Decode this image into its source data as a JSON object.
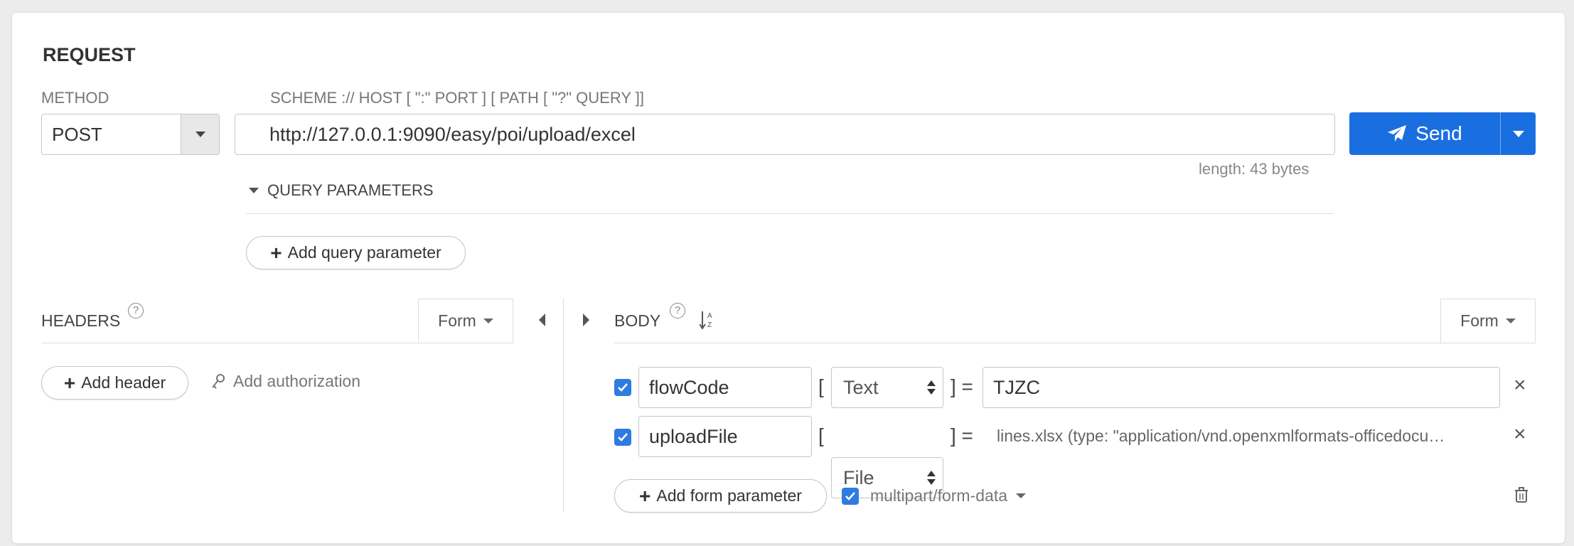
{
  "request": {
    "title": "REQUEST",
    "method_label": "METHOD",
    "method_value": "POST",
    "scheme_label": "SCHEME :// HOST [ \":\" PORT ] [ PATH [ \"?\" QUERY ]]",
    "url": "http://127.0.0.1:9090/easy/poi/upload/excel",
    "length": "length: 43 bytes",
    "send_label": "Send",
    "query_params_label": "QUERY PARAMETERS",
    "add_query_param": "Add query parameter"
  },
  "headers": {
    "label": "HEADERS",
    "mode": "Form",
    "add_header": "Add header",
    "add_authorization": "Add authorization"
  },
  "body": {
    "label": "BODY",
    "mode": "Form",
    "params": [
      {
        "enabled": true,
        "name": "flowCode",
        "type": "Text",
        "value": "TJZC"
      },
      {
        "enabled": true,
        "name": "uploadFile",
        "type": "File",
        "value": "lines.xlsx (type: \"application/vnd.openxmlformats-officedocu…"
      }
    ],
    "add_form_param": "Add form parameter",
    "encoding_enabled": true,
    "encoding": "multipart/form-data"
  },
  "colors": {
    "accent": "#1a6fe0",
    "checkbox": "#2f7be0"
  }
}
